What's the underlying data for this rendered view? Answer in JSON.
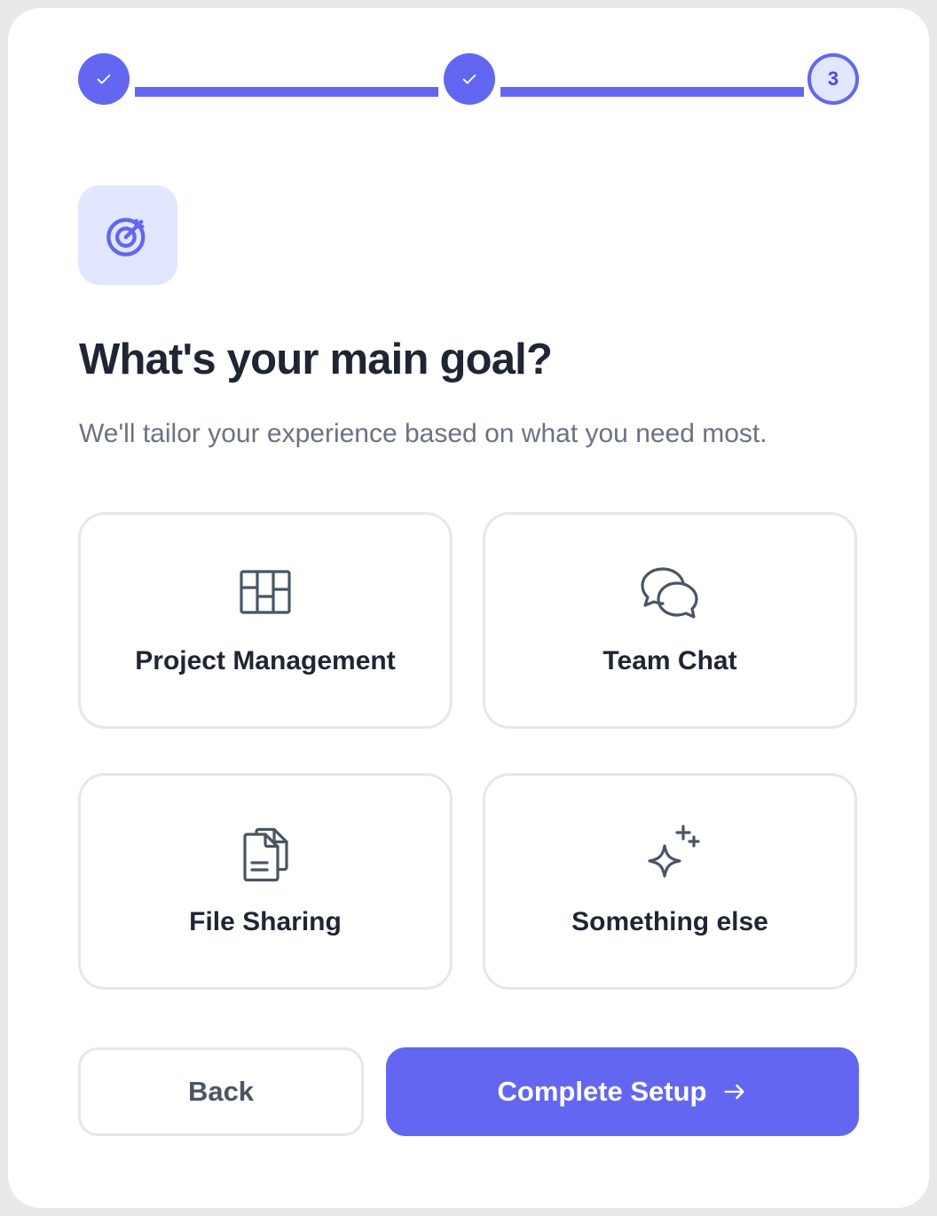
{
  "stepper": {
    "steps": [
      {
        "state": "done",
        "icon": "check-icon"
      },
      {
        "state": "done",
        "icon": "check-icon"
      },
      {
        "state": "current",
        "number": "3"
      }
    ]
  },
  "header": {
    "icon": "target-icon",
    "title": "What's your main goal?",
    "subtitle": "We'll tailor your experience based on what you need most."
  },
  "options": [
    {
      "label": "Project Management",
      "icon": "kanban-board-icon"
    },
    {
      "label": "Team Chat",
      "icon": "chat-bubbles-icon"
    },
    {
      "label": "File Sharing",
      "icon": "documents-icon"
    },
    {
      "label": "Something else",
      "icon": "sparkles-icon"
    }
  ],
  "actions": {
    "back_label": "Back",
    "complete_label": "Complete Setup",
    "complete_icon": "arrow-right-icon"
  },
  "colors": {
    "accent": "#6366f1",
    "accent_light": "#e0e7ff",
    "title_text": "#1f2533",
    "muted_text": "#6b7280",
    "border": "#e5e7eb"
  }
}
